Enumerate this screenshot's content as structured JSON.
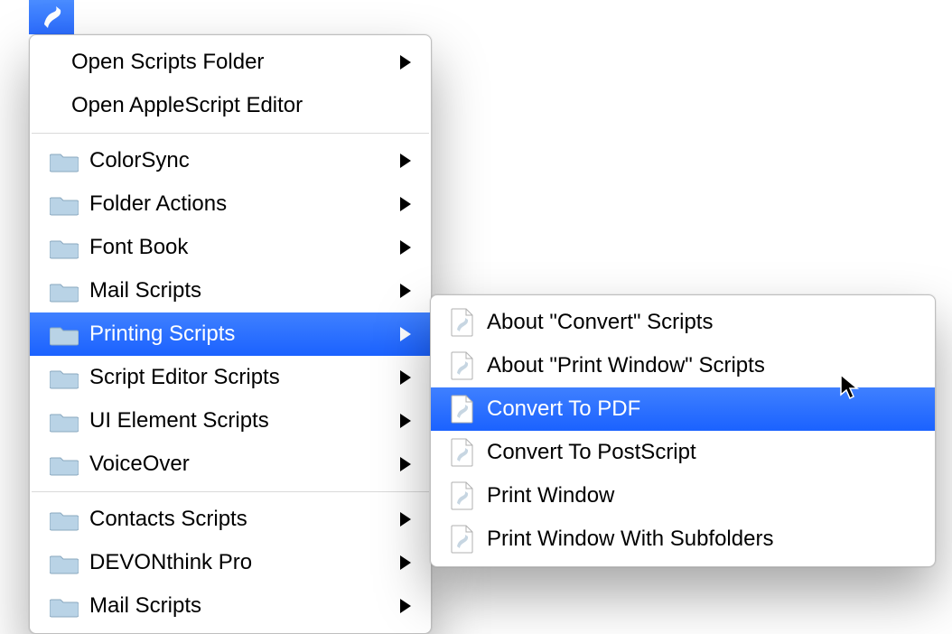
{
  "menubar": {
    "title": "Script Menu"
  },
  "menu": {
    "group1": [
      {
        "label": "Open Scripts Folder",
        "submenu": true
      },
      {
        "label": "Open AppleScript Editor",
        "submenu": false
      }
    ],
    "group2": [
      {
        "label": "ColorSync"
      },
      {
        "label": "Folder Actions"
      },
      {
        "label": "Font Book"
      },
      {
        "label": "Mail Scripts"
      },
      {
        "label": "Printing Scripts",
        "selected": true
      },
      {
        "label": "Script Editor Scripts"
      },
      {
        "label": "UI Element Scripts"
      },
      {
        "label": "VoiceOver"
      }
    ],
    "group3": [
      {
        "label": "Contacts Scripts"
      },
      {
        "label": "DEVONthink Pro"
      },
      {
        "label": "Mail Scripts"
      }
    ]
  },
  "submenu": {
    "items": [
      {
        "label": "About \"Convert\" Scripts"
      },
      {
        "label": "About \"Print Window\" Scripts"
      },
      {
        "label": "Convert To PDF",
        "selected": true
      },
      {
        "label": "Convert To PostScript"
      },
      {
        "label": "Print Window"
      },
      {
        "label": "Print Window With Subfolders"
      }
    ]
  },
  "colors": {
    "highlight_top": "#3f80ff",
    "highlight_bottom": "#1b62ff",
    "folder_fill": "#b9d3e6",
    "folder_stroke": "#8aa8bf"
  }
}
